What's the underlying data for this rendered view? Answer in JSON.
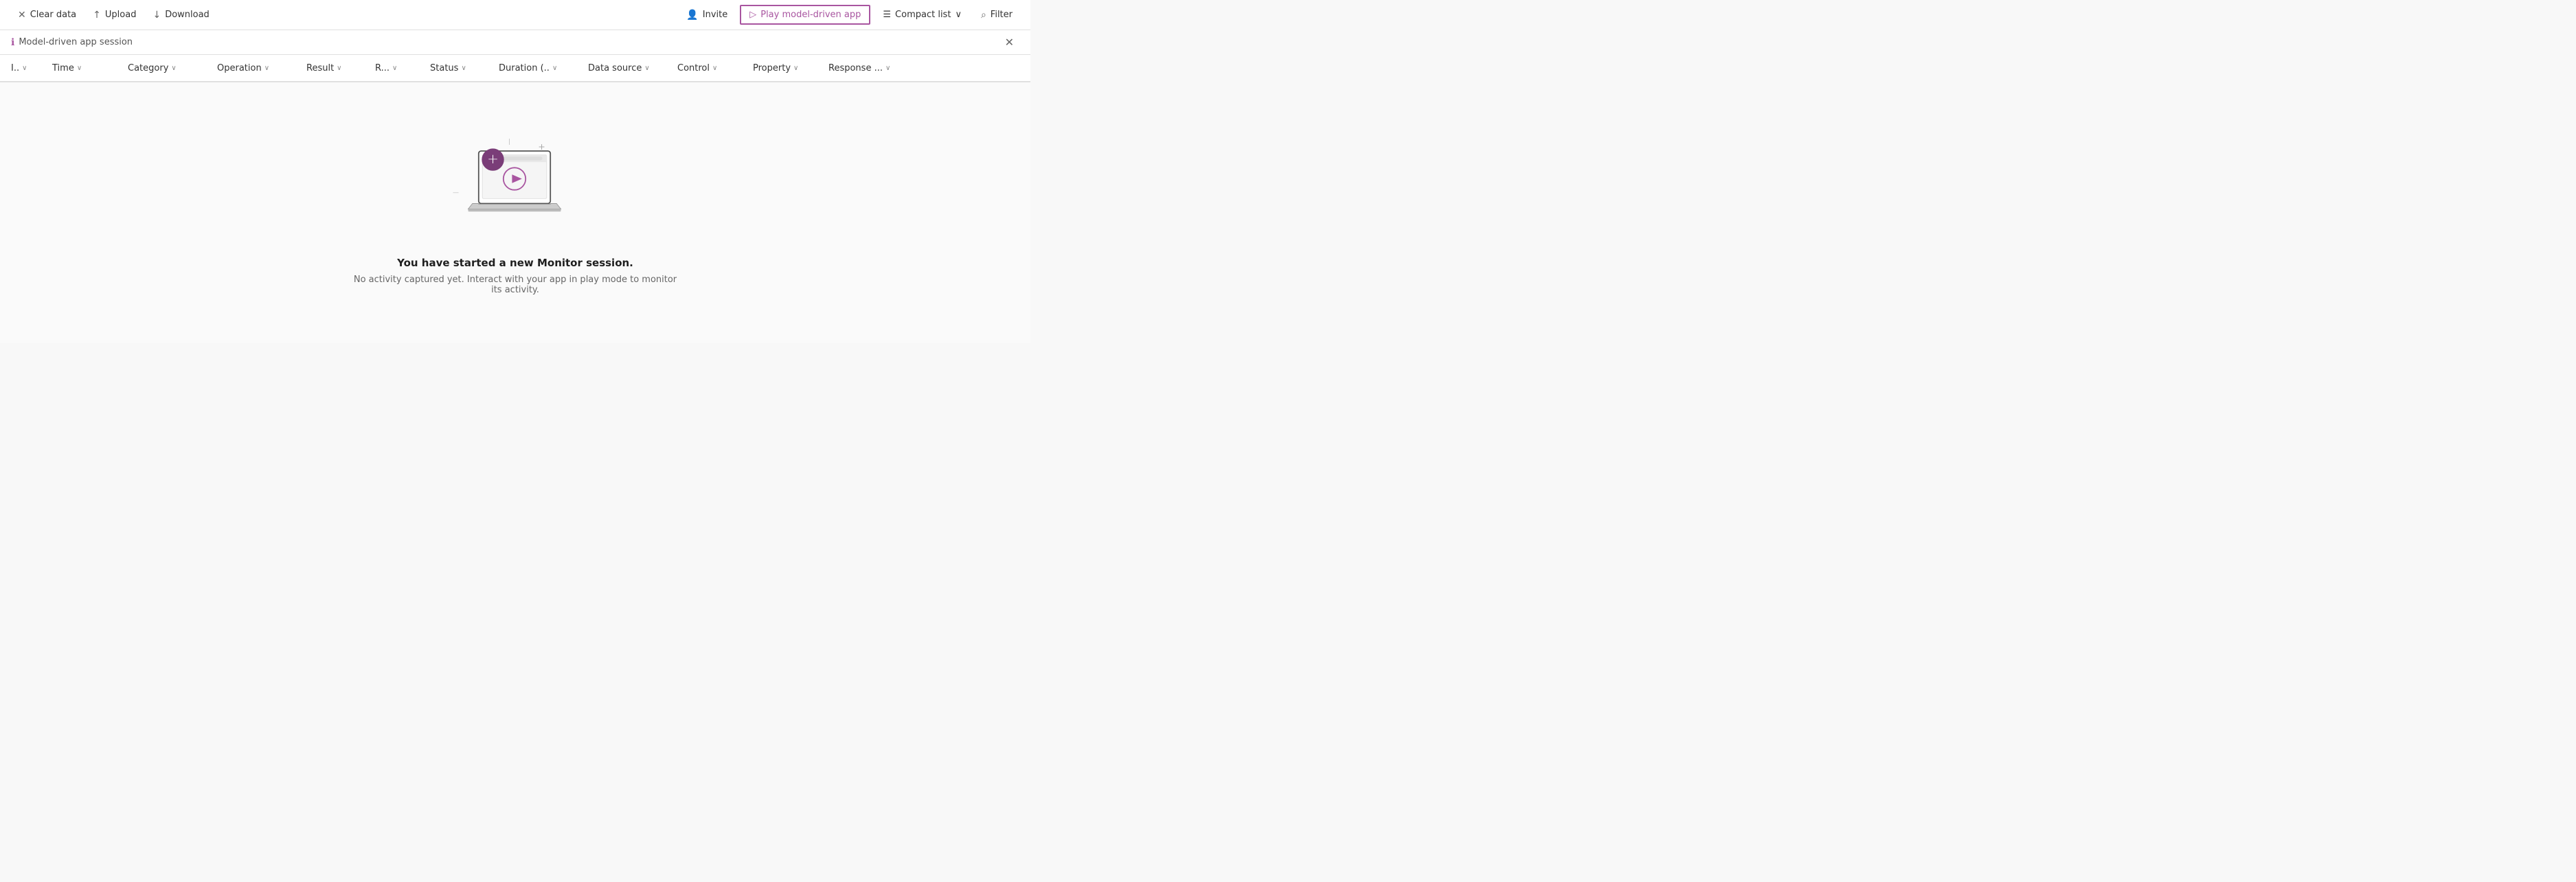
{
  "toolbar": {
    "clear_data_label": "Clear data",
    "upload_label": "Upload",
    "download_label": "Download",
    "invite_label": "Invite",
    "play_label": "Play model-driven app",
    "compact_list_label": "Compact list",
    "filter_label": "Filter"
  },
  "session": {
    "info_icon": "ℹ",
    "label": "Model-driven app session",
    "close_icon": "✕"
  },
  "columns": [
    {
      "id": "col-id",
      "label": "I..",
      "has_chevron": true
    },
    {
      "id": "col-time",
      "label": "Time",
      "has_chevron": true
    },
    {
      "id": "col-category",
      "label": "Category",
      "has_chevron": true
    },
    {
      "id": "col-operation",
      "label": "Operation",
      "has_chevron": true
    },
    {
      "id": "col-result",
      "label": "Result",
      "has_chevron": true
    },
    {
      "id": "col-r",
      "label": "R...",
      "has_chevron": true
    },
    {
      "id": "col-status",
      "label": "Status",
      "has_chevron": true
    },
    {
      "id": "col-duration",
      "label": "Duration (..",
      "has_chevron": true
    },
    {
      "id": "col-datasource",
      "label": "Data source",
      "has_chevron": true
    },
    {
      "id": "col-control",
      "label": "Control",
      "has_chevron": true
    },
    {
      "id": "col-property",
      "label": "Property",
      "has_chevron": true
    },
    {
      "id": "col-response",
      "label": "Response ...",
      "has_chevron": true
    }
  ],
  "empty_state": {
    "title": "You have started a new Monitor session.",
    "subtitle": "No activity captured yet. Interact with your app in play mode to monitor its activity."
  },
  "colors": {
    "accent": "#a855a0",
    "accent_dark": "#7a3d78"
  }
}
